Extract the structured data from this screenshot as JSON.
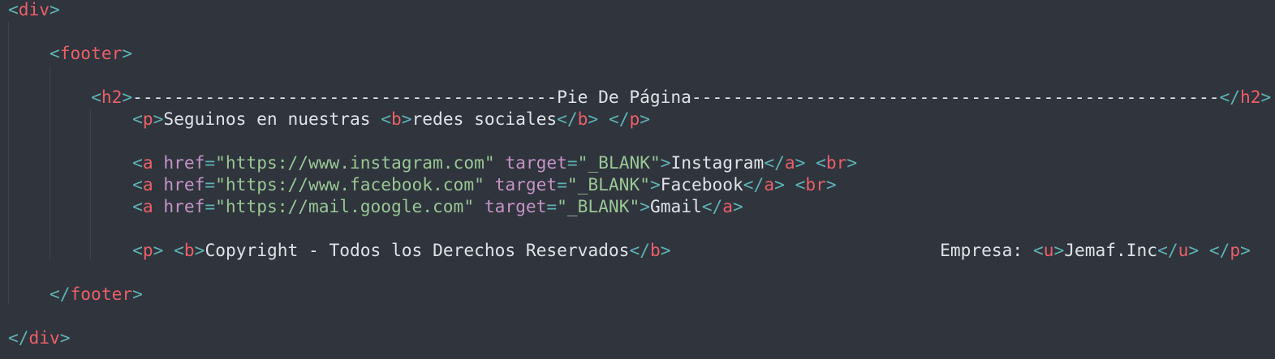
{
  "lines": [
    [
      {
        "c": "p",
        "t": "<"
      },
      {
        "c": "t",
        "t": "div"
      },
      {
        "c": "p",
        "t": ">"
      }
    ],
    [],
    [
      {
        "c": "x",
        "t": "    "
      },
      {
        "c": "p",
        "t": "<"
      },
      {
        "c": "t",
        "t": "footer"
      },
      {
        "c": "p",
        "t": ">"
      }
    ],
    [],
    [
      {
        "c": "x",
        "t": "        "
      },
      {
        "c": "p",
        "t": "<"
      },
      {
        "c": "t",
        "t": "h2"
      },
      {
        "c": "p",
        "t": ">"
      },
      {
        "c": "x",
        "t": "-----------------------------------------Pie De Página---------------------------------------------------"
      },
      {
        "c": "p",
        "t": "</"
      },
      {
        "c": "t",
        "t": "h2"
      },
      {
        "c": "p",
        "t": ">"
      }
    ],
    [
      {
        "c": "x",
        "t": "            "
      },
      {
        "c": "p",
        "t": "<"
      },
      {
        "c": "t",
        "t": "p"
      },
      {
        "c": "p",
        "t": ">"
      },
      {
        "c": "x",
        "t": "Seguinos en nuestras "
      },
      {
        "c": "p",
        "t": "<"
      },
      {
        "c": "t",
        "t": "b"
      },
      {
        "c": "p",
        "t": ">"
      },
      {
        "c": "x",
        "t": "redes sociales"
      },
      {
        "c": "p",
        "t": "</"
      },
      {
        "c": "t",
        "t": "b"
      },
      {
        "c": "p",
        "t": ">"
      },
      {
        "c": "x",
        "t": " "
      },
      {
        "c": "p",
        "t": "</"
      },
      {
        "c": "t",
        "t": "p"
      },
      {
        "c": "p",
        "t": ">"
      }
    ],
    [],
    [
      {
        "c": "x",
        "t": "            "
      },
      {
        "c": "p",
        "t": "<"
      },
      {
        "c": "t",
        "t": "a"
      },
      {
        "c": "x",
        "t": " "
      },
      {
        "c": "a",
        "t": "href"
      },
      {
        "c": "p",
        "t": "="
      },
      {
        "c": "s",
        "t": "\"https://www.instagram.com\""
      },
      {
        "c": "x",
        "t": " "
      },
      {
        "c": "a",
        "t": "target"
      },
      {
        "c": "p",
        "t": "="
      },
      {
        "c": "s",
        "t": "\"_BLANK\""
      },
      {
        "c": "p",
        "t": ">"
      },
      {
        "c": "x",
        "t": "Instagram"
      },
      {
        "c": "p",
        "t": "</"
      },
      {
        "c": "t",
        "t": "a"
      },
      {
        "c": "p",
        "t": ">"
      },
      {
        "c": "x",
        "t": " "
      },
      {
        "c": "p",
        "t": "<"
      },
      {
        "c": "t",
        "t": "br"
      },
      {
        "c": "p",
        "t": ">"
      }
    ],
    [
      {
        "c": "x",
        "t": "            "
      },
      {
        "c": "p",
        "t": "<"
      },
      {
        "c": "t",
        "t": "a"
      },
      {
        "c": "x",
        "t": " "
      },
      {
        "c": "a",
        "t": "href"
      },
      {
        "c": "p",
        "t": "="
      },
      {
        "c": "s",
        "t": "\"https://www.facebook.com\""
      },
      {
        "c": "x",
        "t": " "
      },
      {
        "c": "a",
        "t": "target"
      },
      {
        "c": "p",
        "t": "="
      },
      {
        "c": "s",
        "t": "\"_BLANK\""
      },
      {
        "c": "p",
        "t": ">"
      },
      {
        "c": "x",
        "t": "Facebook"
      },
      {
        "c": "p",
        "t": "</"
      },
      {
        "c": "t",
        "t": "a"
      },
      {
        "c": "p",
        "t": ">"
      },
      {
        "c": "x",
        "t": " "
      },
      {
        "c": "p",
        "t": "<"
      },
      {
        "c": "t",
        "t": "br"
      },
      {
        "c": "p",
        "t": ">"
      }
    ],
    [
      {
        "c": "x",
        "t": "            "
      },
      {
        "c": "p",
        "t": "<"
      },
      {
        "c": "t",
        "t": "a"
      },
      {
        "c": "x",
        "t": " "
      },
      {
        "c": "a",
        "t": "href"
      },
      {
        "c": "p",
        "t": "="
      },
      {
        "c": "s",
        "t": "\"https://mail.google.com\""
      },
      {
        "c": "x",
        "t": " "
      },
      {
        "c": "a",
        "t": "target"
      },
      {
        "c": "p",
        "t": "="
      },
      {
        "c": "s",
        "t": "\"_BLANK\""
      },
      {
        "c": "p",
        "t": ">"
      },
      {
        "c": "x",
        "t": "Gmail"
      },
      {
        "c": "p",
        "t": "</"
      },
      {
        "c": "t",
        "t": "a"
      },
      {
        "c": "p",
        "t": ">"
      }
    ],
    [],
    [
      {
        "c": "x",
        "t": "            "
      },
      {
        "c": "p",
        "t": "<"
      },
      {
        "c": "t",
        "t": "p"
      },
      {
        "c": "p",
        "t": ">"
      },
      {
        "c": "x",
        "t": " "
      },
      {
        "c": "p",
        "t": "<"
      },
      {
        "c": "t",
        "t": "b"
      },
      {
        "c": "p",
        "t": ">"
      },
      {
        "c": "x",
        "t": "Copyright - Todos los Derechos Reservados"
      },
      {
        "c": "p",
        "t": "</"
      },
      {
        "c": "t",
        "t": "b"
      },
      {
        "c": "p",
        "t": ">"
      },
      {
        "c": "x",
        "t": "                          Empresa: "
      },
      {
        "c": "p",
        "t": "<"
      },
      {
        "c": "t",
        "t": "u"
      },
      {
        "c": "p",
        "t": ">"
      },
      {
        "c": "x",
        "t": "Jemaf.Inc"
      },
      {
        "c": "p",
        "t": "</"
      },
      {
        "c": "t",
        "t": "u"
      },
      {
        "c": "p",
        "t": ">"
      },
      {
        "c": "x",
        "t": " "
      },
      {
        "c": "p",
        "t": "</"
      },
      {
        "c": "t",
        "t": "p"
      },
      {
        "c": "p",
        "t": ">"
      }
    ],
    [],
    [
      {
        "c": "x",
        "t": "    "
      },
      {
        "c": "p",
        "t": "</"
      },
      {
        "c": "t",
        "t": "footer"
      },
      {
        "c": "p",
        "t": ">"
      }
    ],
    [],
    [
      {
        "c": "p",
        "t": "</"
      },
      {
        "c": "t",
        "t": "div"
      },
      {
        "c": "p",
        "t": ">"
      }
    ]
  ],
  "colors": {
    "background": "#2f343d",
    "punctuation": "#5fb3b3",
    "tag": "#ec5f67",
    "attribute": "#c594c5",
    "string": "#99c794",
    "text": "#dfe3e8",
    "indent_guide": "#3e444f"
  }
}
